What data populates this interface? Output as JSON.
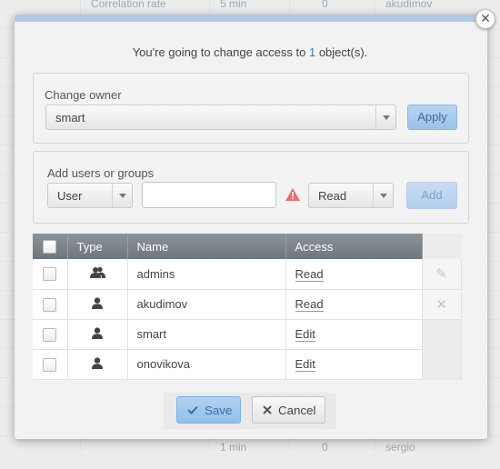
{
  "background": {
    "top_row": [
      "Correlation rate",
      "5 min",
      "0",
      "akudimov"
    ],
    "bottom_row": [
      "1 min",
      "0",
      "sergio"
    ]
  },
  "dialog": {
    "message_prefix": "You're going to change access to ",
    "message_count": "1",
    "message_suffix": " object(s).",
    "close_icon": "close-icon"
  },
  "change_owner": {
    "label": "Change owner",
    "owner_value": "smart",
    "apply_label": "Apply"
  },
  "add_users": {
    "label": "Add users or groups",
    "type_value": "User",
    "name_placeholder": "",
    "warning_icon": "warning-triangle-icon",
    "access_value": "Read",
    "add_label": "Add"
  },
  "acl_table": {
    "headers": {
      "type": "Type",
      "name": "Name",
      "access": "Access"
    },
    "rows": [
      {
        "type_icon": "group-icon",
        "name": "admins",
        "access": "Read",
        "action_icon": "edit-pencil-icon"
      },
      {
        "type_icon": "user-icon",
        "name": "akudimov",
        "access": "Read",
        "action_icon": "remove-x-icon"
      },
      {
        "type_icon": "user-icon",
        "name": "smart",
        "access": "Edit",
        "action_icon": ""
      },
      {
        "type_icon": "user-icon",
        "name": "onovikova",
        "access": "Edit",
        "action_icon": ""
      }
    ]
  },
  "footer": {
    "save_label": "Save",
    "cancel_label": "Cancel",
    "save_icon": "checkmark-icon",
    "cancel_icon": "cross-icon"
  },
  "colors": {
    "accent_blue": "#9cc1ea",
    "header_gray": "#7b8188",
    "warning_red": "#e05a5a",
    "count_blue": "#2f7fd0"
  }
}
